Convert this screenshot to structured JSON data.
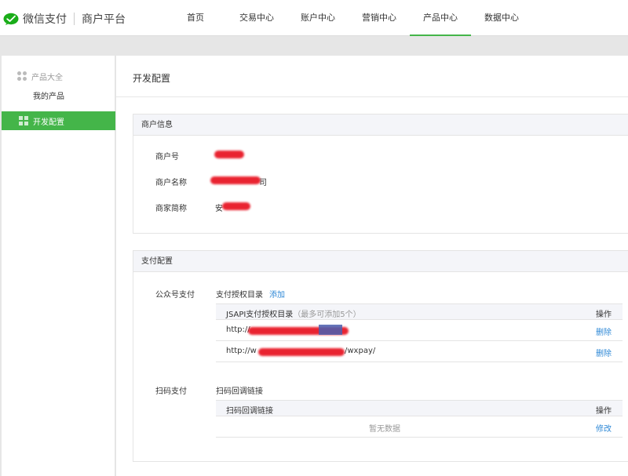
{
  "header": {
    "app_title": "微信支付",
    "app_subtitle": "商户平台",
    "nav": [
      {
        "label": "首页",
        "active": false
      },
      {
        "label": "交易中心",
        "active": false
      },
      {
        "label": "账户中心",
        "active": false
      },
      {
        "label": "营销中心",
        "active": false
      },
      {
        "label": "产品中心",
        "active": true
      },
      {
        "label": "数据中心",
        "active": false
      }
    ]
  },
  "sidebar": {
    "group_label": "产品大全",
    "items": [
      {
        "label": "我的产品",
        "active": false
      },
      {
        "label": "开发配置",
        "active": true
      }
    ]
  },
  "main": {
    "page_title": "开发配置",
    "merchant_info": {
      "title": "商户信息",
      "fields": [
        {
          "label": "商户号",
          "value_prefix": "",
          "value_suffix": ""
        },
        {
          "label": "商户名称",
          "value_prefix": "",
          "value_suffix": "司"
        },
        {
          "label": "商家简称",
          "value_prefix": "安",
          "value_suffix": ""
        }
      ]
    },
    "payment_config": {
      "title": "支付配置",
      "official_account": {
        "label": "公众号支付",
        "sub_label": "支付授权目录",
        "add_link": "添加",
        "table": {
          "header": "JSAPI支付授权目录",
          "header_hint": "（最多可添加5个）",
          "action_header": "操作",
          "rows": [
            {
              "prefix": "http://",
              "suffix": "",
              "action": "删除"
            },
            {
              "prefix": "http://w",
              "suffix": "/wxpay/",
              "action": "删除"
            }
          ]
        }
      },
      "scan_pay": {
        "label": "扫码支付",
        "sub_label": "扫码回调链接",
        "table": {
          "header": "扫码回调链接",
          "action_header": "操作",
          "empty_text": "暂无数据",
          "action": "修改"
        }
      }
    }
  },
  "colors": {
    "brand_green": "#44b549",
    "link_blue": "#2e88d6",
    "redaction_red": "#e8111f"
  }
}
